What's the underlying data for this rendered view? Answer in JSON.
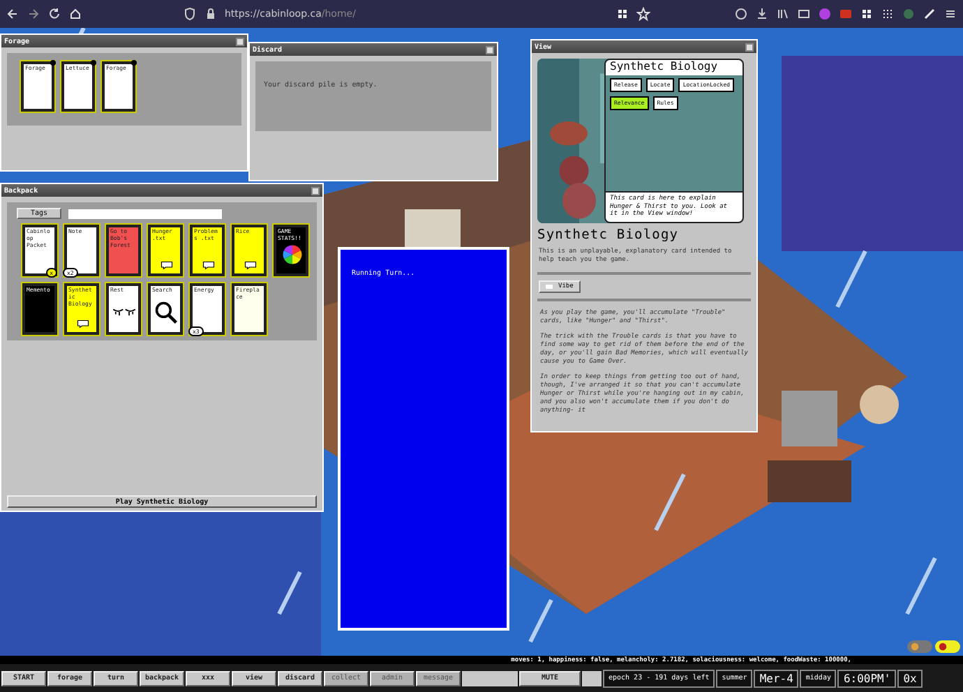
{
  "browser": {
    "url_host": "https://cabinloop.ca",
    "url_path": "/home/"
  },
  "forage": {
    "title": "Forage",
    "cards": [
      {
        "label": "Forage",
        "color": "#ffffff"
      },
      {
        "label": "Lettuce",
        "color": "#ffffff"
      },
      {
        "label": "Forage",
        "color": "#ffffff"
      }
    ]
  },
  "discard": {
    "title": "Discard",
    "message": "Your discard pile is empty."
  },
  "backpack": {
    "title": "Backpack",
    "tags_button": "Tags",
    "cards": [
      {
        "label": "Cabinloop Packet",
        "kind": "text",
        "color": "#ffffff",
        "badge": "x"
      },
      {
        "label": "Note",
        "kind": "text",
        "color": "#ffffff",
        "badge": "x2"
      },
      {
        "label": "Go to Bob's Forest",
        "kind": "text",
        "color": "#f05050"
      },
      {
        "label": "Hunger .txt",
        "kind": "bubble",
        "color": "#ffff00"
      },
      {
        "label": "Problems .txt",
        "kind": "bubble",
        "color": "#ffff00"
      },
      {
        "label": "Rice",
        "kind": "bubble",
        "color": "#ffff00"
      },
      {
        "label": "GAME STATS!!",
        "kind": "palette",
        "color": "#000000"
      },
      {
        "label": "Memento",
        "kind": "text",
        "color": "#000000"
      },
      {
        "label": "Synthetic Biology",
        "kind": "bubble",
        "color": "#ffff00"
      },
      {
        "label": "Rest",
        "kind": "eyes",
        "color": "#ffffff"
      },
      {
        "label": "Search",
        "kind": "magnifier",
        "color": "#ffffff"
      },
      {
        "label": "Energy",
        "kind": "text",
        "color": "#ffffff",
        "badge": "x3"
      },
      {
        "label": "Fireplace",
        "kind": "text",
        "color": "#ffffee"
      }
    ],
    "play_button": "Play Synthetic Biology"
  },
  "running": {
    "text": "Running Turn..."
  },
  "view": {
    "title": "View",
    "card_title": "Synthetc Biology",
    "tags": [
      {
        "label": "Release",
        "selected": false
      },
      {
        "label": "Locate",
        "selected": false
      },
      {
        "label": "LocationLocked",
        "selected": false
      },
      {
        "label": "Relevance",
        "selected": true
      },
      {
        "label": "Rules",
        "selected": false
      }
    ],
    "card_text": "This card is here to explain Hunger & Thirst to you. Look at it in the View window!",
    "heading": "Synthetc Biology",
    "summary": "This is an unplayable, explanatory card intended to help teach you the game.",
    "vibe_button": "Vibe",
    "paragraphs": [
      "As you play the game, you'll accumulate \"Trouble\" cards, like \"Hunger\" and \"Thirst\".",
      "The trick with the Trouble cards is that you have to find some way to get rid of them before the end of the day, or you'll gain Bad Memories, which will eventually cause you to Game Over.",
      "In order to keep things from getting too out of hand, though, I've arranged it so that you can't accumulate Hunger or Thirst while you're hanging out in my cabin, and you also won't accumulate them if you don't do anything- it"
    ]
  },
  "status": "moves: 1, happiness: false, melancholy: 2.7182, solaciousness: welcome, foodWaste: 100000,",
  "taskbar": {
    "buttons": [
      {
        "label": "START",
        "disabled": false
      },
      {
        "label": "forage",
        "disabled": false
      },
      {
        "label": "turn",
        "disabled": false
      },
      {
        "label": "backpack",
        "disabled": false
      },
      {
        "label": "xxx",
        "disabled": false
      },
      {
        "label": "view",
        "disabled": false
      },
      {
        "label": "discard",
        "disabled": false
      },
      {
        "label": "collect",
        "disabled": true
      },
      {
        "label": "admin",
        "disabled": true
      },
      {
        "label": "message",
        "disabled": true
      }
    ],
    "mute": "MUTE",
    "epoch": "epoch 23 - 191 days left",
    "season": "summer",
    "weekday": "Mer-4",
    "daypart": "midday",
    "time": "6:00PM'",
    "speed": "0x"
  }
}
